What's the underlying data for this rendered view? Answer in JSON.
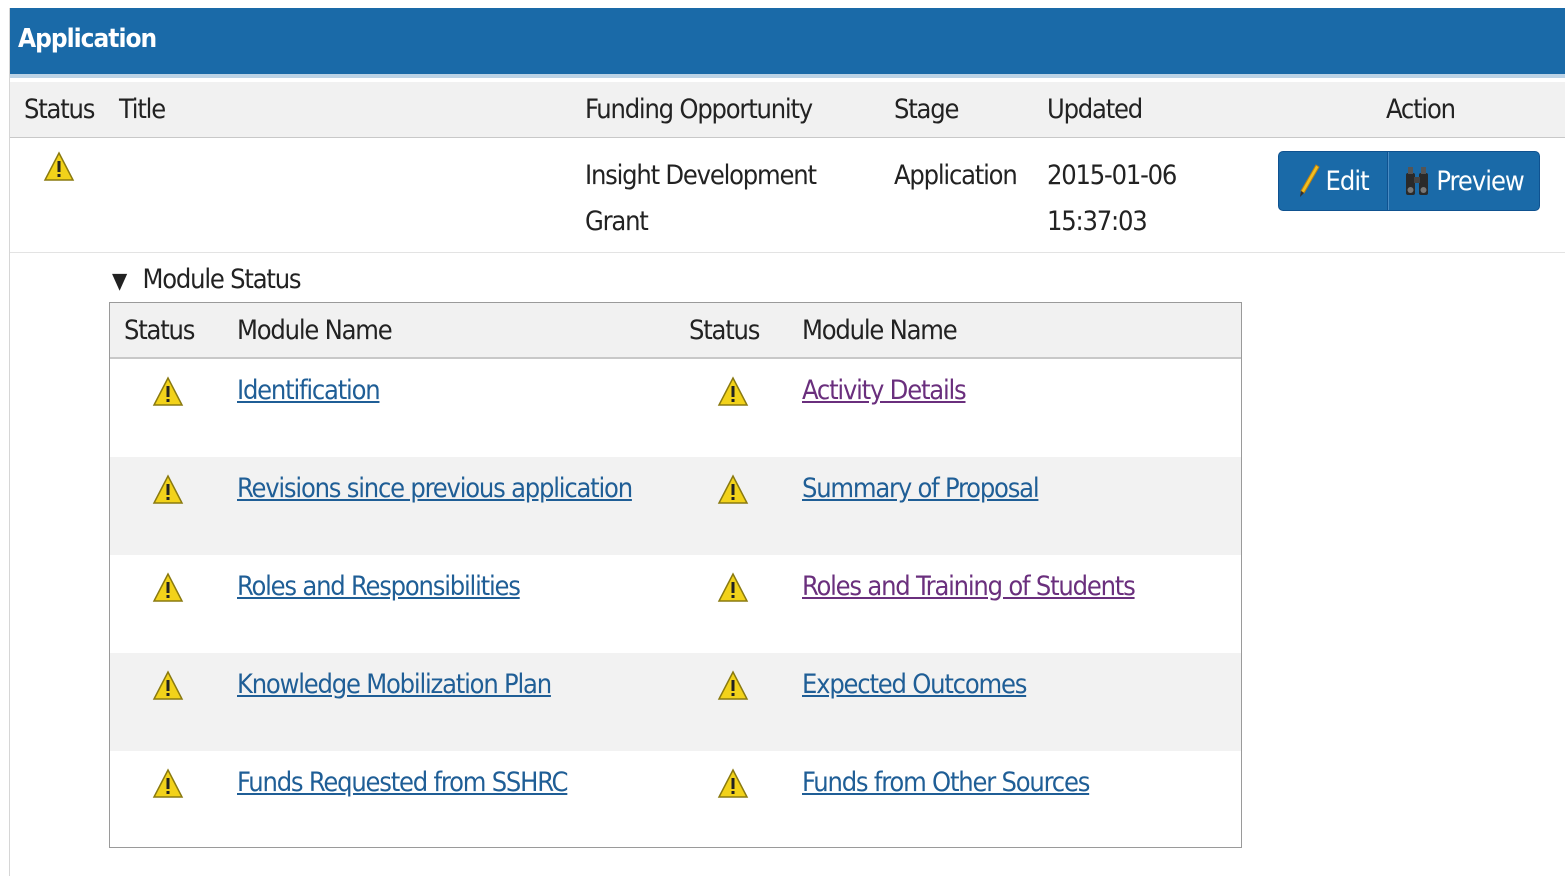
{
  "panel": {
    "title": "Application"
  },
  "app_table": {
    "headers": {
      "status": "Status",
      "title": "Title",
      "funding": "Funding Opportunity",
      "stage": "Stage",
      "updated": "Updated",
      "action": "Action"
    },
    "row": {
      "status_icon": "warning-icon",
      "title": "",
      "funding_line1": "Insight Development",
      "funding_line2": "Grant",
      "stage": "Application",
      "updated_date": "2015-01-06",
      "updated_time": "15:37:03",
      "edit_label": "Edit",
      "preview_label": "Preview"
    }
  },
  "modules": {
    "toggle_label": "Module Status",
    "headers": {
      "status_left": "Status",
      "name_left": "Module Name",
      "status_right": "Status",
      "name_right": "Module Name"
    },
    "rows": [
      {
        "left": "Identification",
        "right": "Activity Details"
      },
      {
        "left": "Revisions since previous application",
        "right": "Summary of Proposal"
      },
      {
        "left": "Roles and Responsibilities",
        "right": "Roles and Training of Students"
      },
      {
        "left": "Knowledge Mobilization Plan",
        "right": "Expected Outcomes"
      },
      {
        "left": "Funds Requested from SSHRC",
        "right": "Funds from Other Sources"
      }
    ]
  },
  "colors": {
    "header_blue": "#1a6aa8",
    "link": "#1f5e96",
    "visited_link": "#6a2f7d",
    "warning_yellow": "#f2d21a"
  }
}
